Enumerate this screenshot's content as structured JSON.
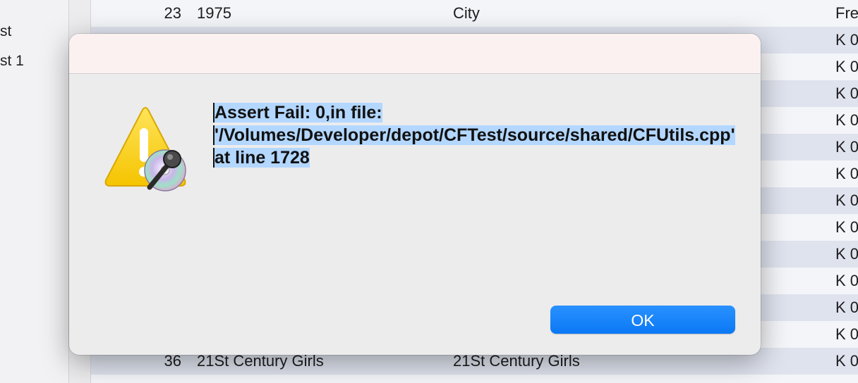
{
  "sidebar": {
    "items": [
      {
        "label": "st"
      },
      {
        "label": "st 1"
      }
    ]
  },
  "table": {
    "rows": [
      {
        "num": "23",
        "title": "1975",
        "artist": "City",
        "last": "Fre"
      },
      {
        "num": "",
        "title": "",
        "artist": "",
        "last": "K 0"
      },
      {
        "num": "",
        "title": "",
        "artist": "",
        "last": "K 0"
      },
      {
        "num": "",
        "title": "",
        "artist": "",
        "last": "K 0"
      },
      {
        "num": "",
        "title": "",
        "artist": "",
        "last": "K 0"
      },
      {
        "num": "",
        "title": "",
        "artist": "",
        "last": "K 0"
      },
      {
        "num": "",
        "title": "",
        "artist": "",
        "last": "K 0"
      },
      {
        "num": "",
        "title": "",
        "artist": "",
        "last": "K 0"
      },
      {
        "num": "",
        "title": "",
        "artist": "",
        "last": "K 0"
      },
      {
        "num": "",
        "title": "",
        "artist": "",
        "last": "K 0"
      },
      {
        "num": "",
        "title": "",
        "artist": "",
        "last": "K 0"
      },
      {
        "num": "",
        "title": "",
        "artist": "",
        "last": "K 0"
      },
      {
        "num": "",
        "title": "",
        "artist": "",
        "last": "K 0"
      },
      {
        "num": "36",
        "title": "21St Century Girls",
        "artist": "21St Century Girls",
        "last": "K 0"
      }
    ]
  },
  "dialog": {
    "icon": "warning-icon",
    "badge_icon": "microphone-disc-icon",
    "message": "Assert Fail: 0,in file: '/Volumes/Developer/depot/CFTest/source/shared/CFUtils.cpp' at line 1728",
    "ok_label": "OK",
    "accent_color": "#0a78f5",
    "selection_color": "#b3d7ff"
  }
}
